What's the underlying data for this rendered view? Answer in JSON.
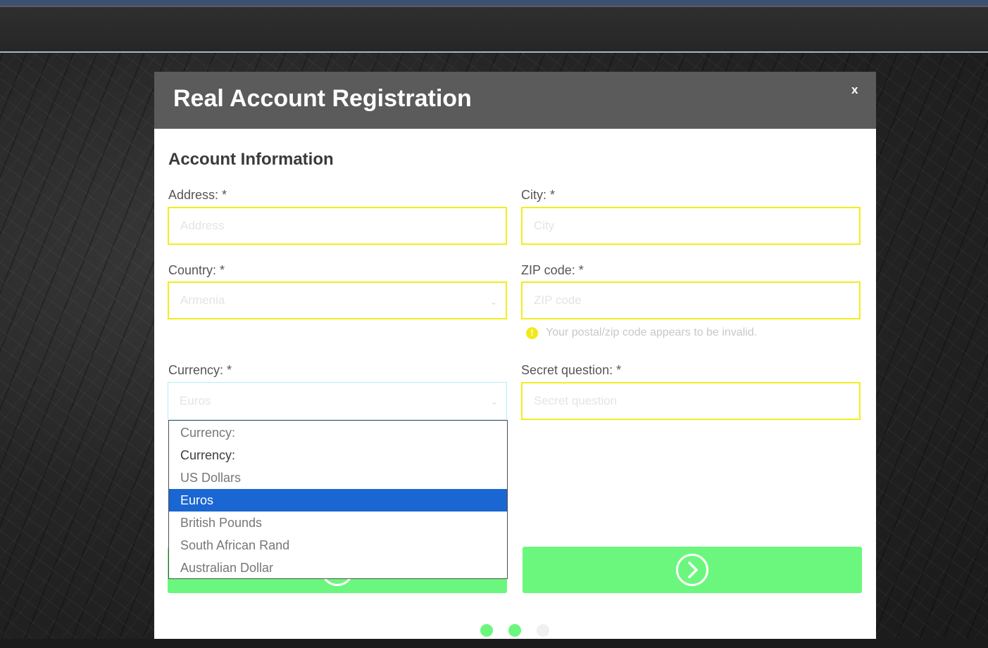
{
  "modal": {
    "title": "Real Account Registration",
    "close_label": "x"
  },
  "section": {
    "title": "Account Information"
  },
  "fields": {
    "address": {
      "label": "Address: *",
      "placeholder": "Address"
    },
    "city": {
      "label": "City: *",
      "placeholder": "City"
    },
    "country": {
      "label": "Country: *",
      "value": "Armenia"
    },
    "zip": {
      "label": "ZIP code: *",
      "placeholder": "ZIP code",
      "hint": "Your postal/zip code appears to be invalid."
    },
    "currency": {
      "label": "Currency: *",
      "value": "Euros"
    },
    "secret": {
      "label": "Secret question: *",
      "placeholder": "Secret question"
    }
  },
  "currency_options": [
    {
      "label": "Currency:",
      "selected": false
    },
    {
      "label": "Currency:",
      "selected": false
    },
    {
      "label": "US Dollars",
      "selected": false
    },
    {
      "label": "Euros",
      "selected": true
    },
    {
      "label": "British Pounds",
      "selected": false
    },
    {
      "label": "South African Rand",
      "selected": false
    },
    {
      "label": "Australian Dollar",
      "selected": false
    }
  ],
  "icons": {
    "close": "close-icon",
    "warning": "warning-icon",
    "back": "arrow-left-circle-icon",
    "next": "arrow-right-circle-icon",
    "chevron": "chevron-down-icon"
  },
  "step_indicator": {
    "total": 3,
    "completed": 2
  },
  "colors": {
    "accent_green": "#6bf77d",
    "warning_yellow": "#f2ee1b",
    "selection_blue": "#1a66d2",
    "step_inactive": "#f0f0f0"
  }
}
